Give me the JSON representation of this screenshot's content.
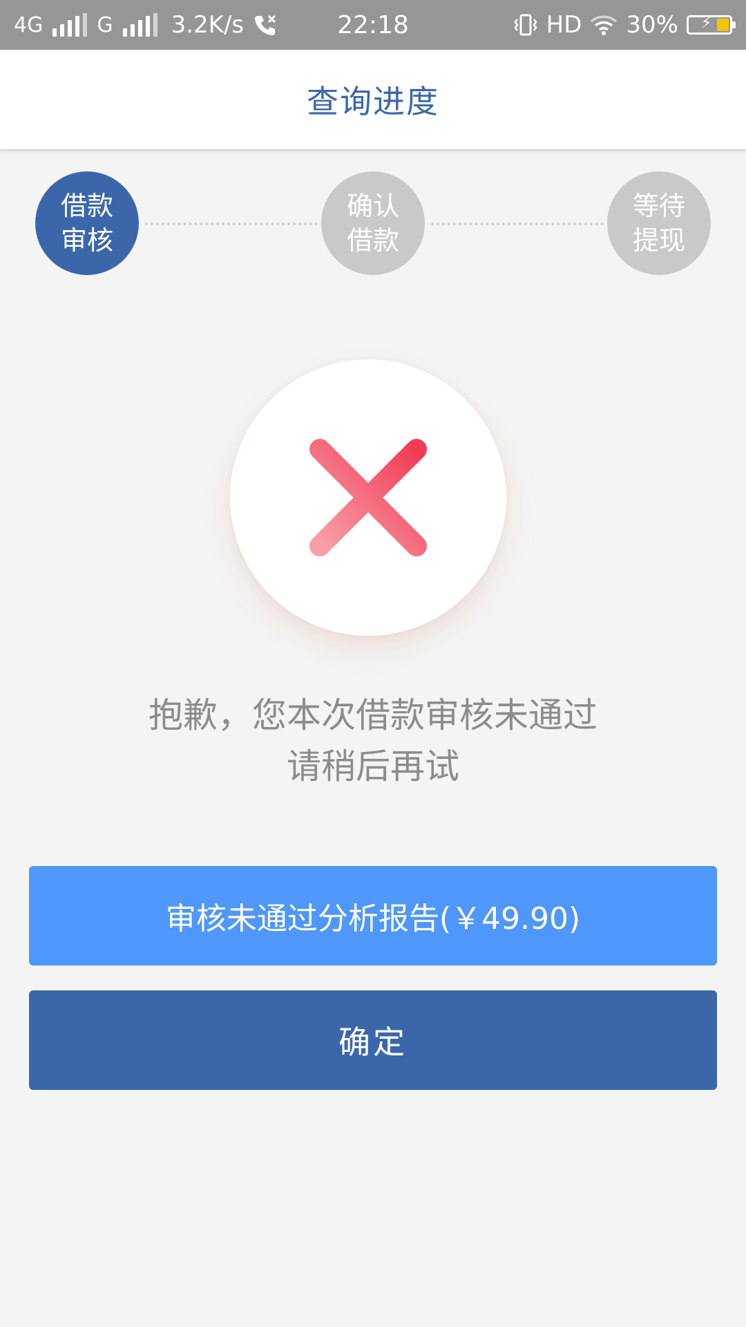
{
  "status_bar": {
    "network_1": "4G",
    "network_2": "G",
    "speed": "3.2K/s",
    "time": "22:18",
    "hd": "HD",
    "battery_percent": "30%",
    "battery_level": 0.3,
    "battery_color": "#f5c400"
  },
  "header": {
    "title": "查询进度"
  },
  "steps": [
    {
      "line1": "借款",
      "line2": "审核",
      "state": "active"
    },
    {
      "line1": "确认",
      "line2": "借款",
      "state": "pending"
    },
    {
      "line1": "等待",
      "line2": "提现",
      "state": "pending"
    }
  ],
  "result": {
    "icon": "close-icon",
    "icon_color": "#f05a6e",
    "message_line1": "抱歉，您本次借款审核未通过",
    "message_line2": "请稍后再试"
  },
  "buttons": {
    "report_label": "审核未通过分析报告(￥49.90)",
    "confirm_label": "确定"
  },
  "colors": {
    "primary": "#3b67aa",
    "accent": "#4f97fa",
    "inactive": "#c9c9c9"
  }
}
